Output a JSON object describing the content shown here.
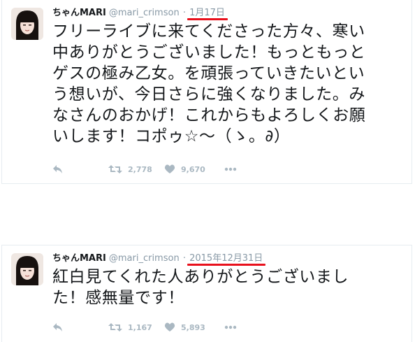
{
  "tweets": [
    {
      "name": "ちゃんMARI",
      "handle": "@mari_crimson",
      "separator": "·",
      "date": "1月17日",
      "lines": [
        "フリーライブに来てくださった方々、寒い",
        "中ありがとうございました！もっともっと",
        "ゲスの極み乙女。を頑張っていきたいとい",
        "う想いが、今日さらに強くなりました。み",
        "なさんのおかげ！これからもよろしくお願",
        "いします！コポゥ☆～（ゝ。∂）"
      ],
      "retweets": "2,778",
      "likes": "9,670"
    },
    {
      "name": "ちゃんMARI",
      "handle": "@mari_crimson",
      "separator": "·",
      "date": "2015年12月31日",
      "lines": [
        "紅白見てくれた人ありがとうございまし",
        "た！感無量です！"
      ],
      "retweets": "1,167",
      "likes": "5,893"
    }
  ],
  "icons": {
    "reply": "reply-icon",
    "retweet": "retweet-icon",
    "like": "heart-icon",
    "more": "more-icon"
  },
  "colors": {
    "text": "#14171a",
    "muted": "#8899a6",
    "action": "#aab8c2",
    "date_underline": "#e8101c",
    "divider": "#e6ecf0"
  }
}
